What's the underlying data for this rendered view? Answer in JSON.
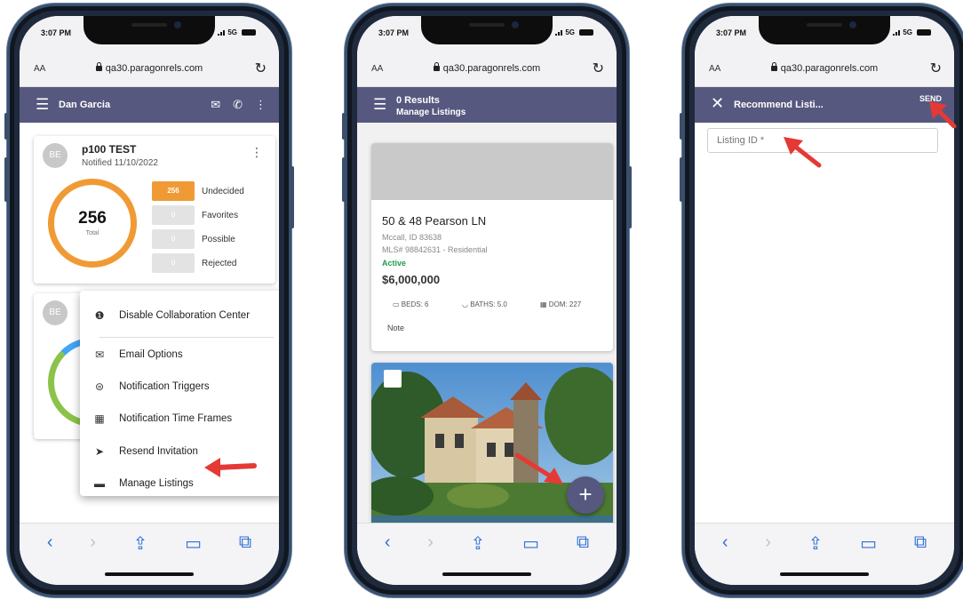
{
  "colors": {
    "appbar": "#57587f",
    "accent_orange": "#f09a35",
    "active_green": "#1e9e4a",
    "arrow_red": "#e53935"
  },
  "browser": {
    "time": "3:07 PM",
    "signal": "5G",
    "aa": "AA",
    "url": "qa30.paragonrels.com"
  },
  "phone1": {
    "header_title": "Dan Garcia",
    "card1": {
      "avatar": "BE",
      "title": "p100 TEST",
      "notified": "Notified 11/10/2022",
      "total_value": "256",
      "total_label": "Total",
      "stats": [
        {
          "value": "256",
          "label": "Undecided"
        },
        {
          "value": "0",
          "label": "Favorites"
        },
        {
          "value": "0",
          "label": "Possible"
        },
        {
          "value": "0",
          "label": "Rejected"
        }
      ]
    },
    "card2": {
      "avatar": "BE"
    },
    "menu": [
      {
        "icon": "info-icon",
        "label": "Disable Collaboration Center"
      },
      {
        "icon": "mail-icon",
        "label": "Email Options"
      },
      {
        "icon": "toggle-icon",
        "label": "Notification Triggers"
      },
      {
        "icon": "calendar-clock-icon",
        "label": "Notification Time Frames"
      },
      {
        "icon": "send-icon",
        "label": "Resend Invitation"
      },
      {
        "icon": "folder-icon",
        "label": "Manage Listings"
      }
    ]
  },
  "phone2": {
    "header_title": "0 Results",
    "header_sub": "Manage Listings",
    "listing": {
      "address": "50 & 48 Pearson LN",
      "city": "Mccall, ID 83638",
      "mls": "MLS# 98842631 - Residential",
      "status": "Active",
      "price": "$6,000,000",
      "beds": "BEDS: 6",
      "baths": "BATHS: 5.0",
      "dom": "DOM: 227",
      "note": "Note"
    }
  },
  "phone3": {
    "header_title": "Recommend Listi...",
    "send_label": "SEND",
    "listing_id_placeholder": "Listing ID *"
  }
}
